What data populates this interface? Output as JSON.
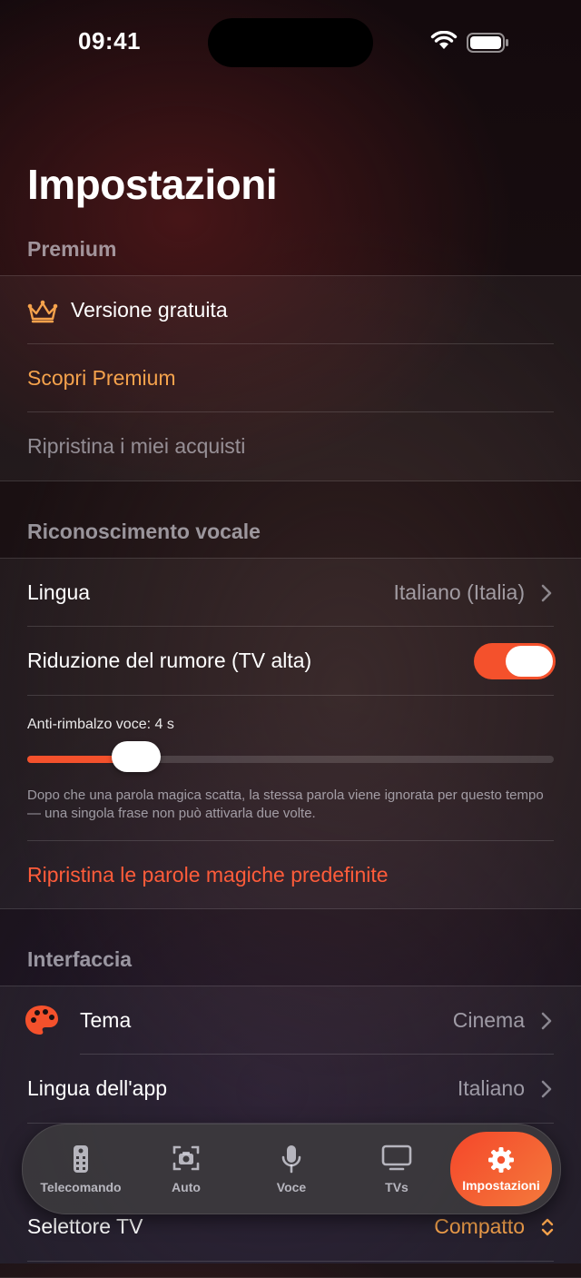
{
  "status_bar": {
    "time": "09:41"
  },
  "page_title": "Impostazioni",
  "sections": {
    "premium": {
      "header": "Premium",
      "free_version": "Versione gratuita",
      "discover": "Scopri Premium",
      "restore": "Ripristina i miei acquisti"
    },
    "voice": {
      "header": "Riconoscimento vocale",
      "language_label": "Lingua",
      "language_value": "Italiano (Italia)",
      "noise_label": "Riduzione del rumore (TV alta)",
      "noise_enabled": true,
      "debounce_label": "Anti-rimbalzo voce: 4 s",
      "debounce_value": 4,
      "debounce_fraction": 0.16,
      "debounce_description": "Dopo che una parola magica scatta, la stessa parola viene ignorata per questo tempo — una singola frase non può attivarla due volte.",
      "reset_magic_words": "Ripristina le parole magiche predefinite"
    },
    "interface": {
      "header": "Interfaccia",
      "theme_label": "Tema",
      "theme_value": "Cinema",
      "app_language_label": "Lingua dell'app",
      "app_language_value": "Italiano",
      "tv_selector_label": "Selettore TV",
      "tv_selector_value": "Compatto"
    }
  },
  "tabs": [
    {
      "label": "Telecomando",
      "icon": "remote-icon"
    },
    {
      "label": "Auto",
      "icon": "camera-scan-icon"
    },
    {
      "label": "Voce",
      "icon": "microphone-icon"
    },
    {
      "label": "TVs",
      "icon": "tv-icon"
    },
    {
      "label": "Impostazioni",
      "icon": "gear-icon",
      "active": true
    }
  ],
  "colors": {
    "accent": "#f4512c",
    "premium": "#f5a24c",
    "destructive": "#ff5c3a"
  }
}
